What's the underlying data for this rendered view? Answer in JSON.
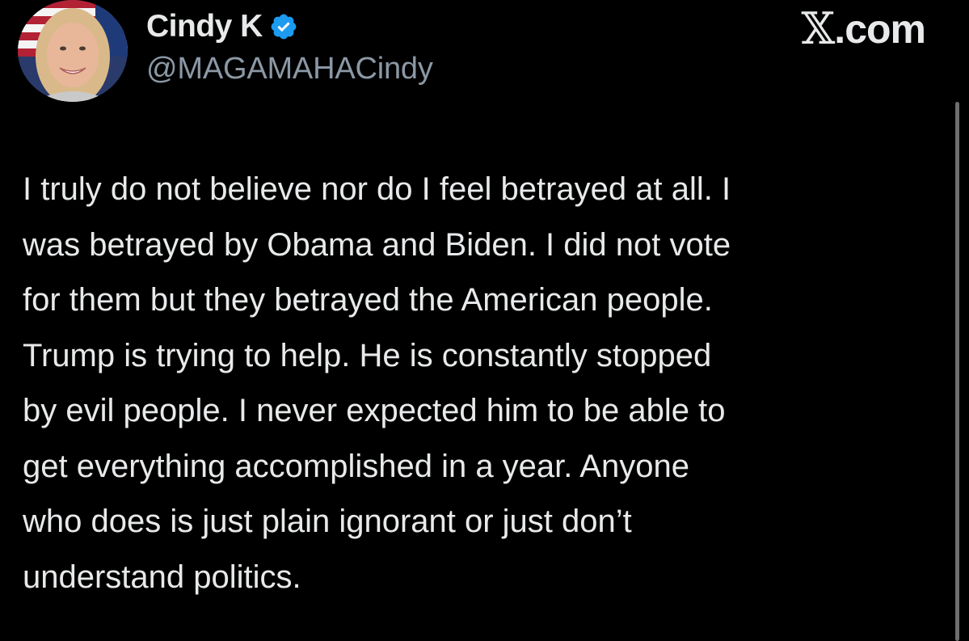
{
  "author": {
    "display_name": "Cindy K",
    "handle": "@MAGAMAHACindy",
    "verified": true,
    "verified_color": "#1d9bf0"
  },
  "brand": {
    "mark": "𝕏",
    "suffix": ".com"
  },
  "tweet": {
    "lines": [
      "I truly do not believe nor do I feel betrayed at all. I",
      "was betrayed by Obama and Biden. I did not vote",
      "for them but they betrayed the American people.",
      "Trump is trying to help. He is constantly stopped",
      "by evil people. I never expected him to be able to",
      "get everything accomplished in a year. Anyone",
      "who does is just plain ignorant or just don’t",
      "understand politics."
    ]
  },
  "colors": {
    "background": "#000000",
    "text": "#e7e9ea",
    "secondary_text": "#8b98a5",
    "accent": "#1d9bf0"
  },
  "icons": {
    "avatar": "profile-photo",
    "verified": "verified-badge-icon",
    "brand": "x-logo-icon"
  }
}
